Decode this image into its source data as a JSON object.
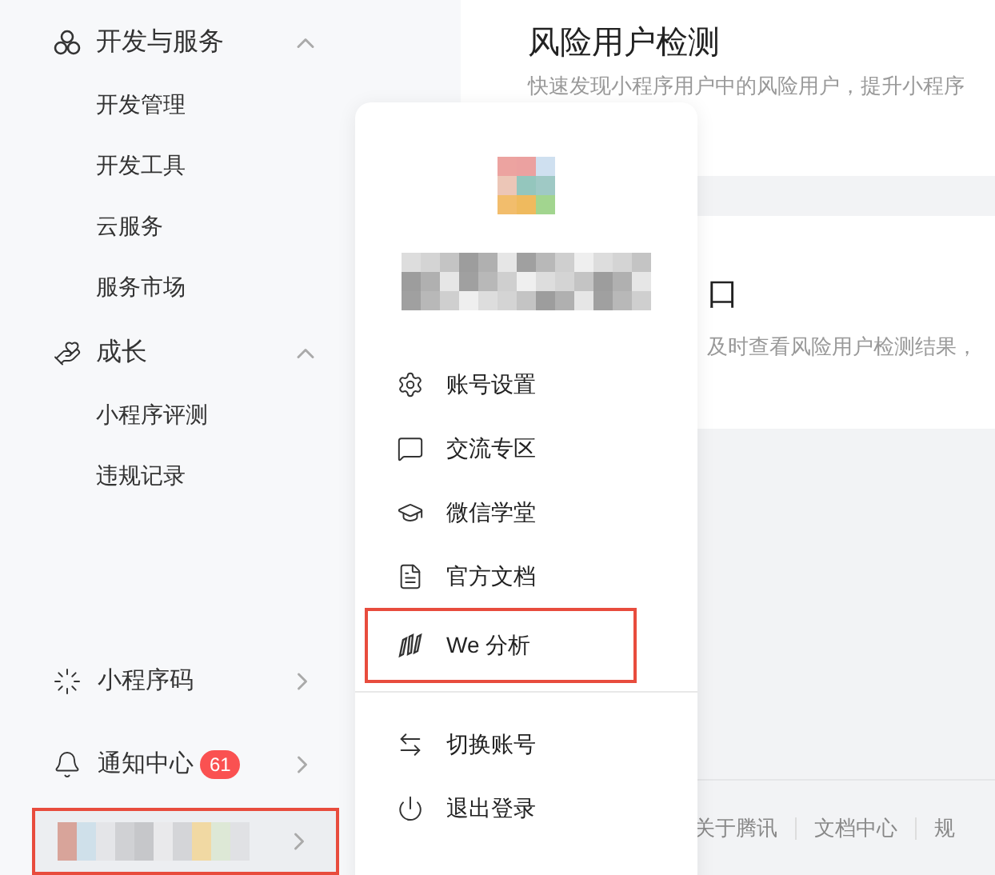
{
  "sidebar": {
    "groups": [
      {
        "title": "开发与服务",
        "expanded": true,
        "items": [
          "开发管理",
          "开发工具",
          "云服务",
          "服务市场"
        ]
      },
      {
        "title": "成长",
        "expanded": true,
        "items": [
          "小程序评测",
          "违规记录"
        ]
      }
    ],
    "bottom_items": [
      {
        "label": "小程序码"
      },
      {
        "label": "通知中心",
        "badge": "61"
      }
    ],
    "account": {
      "highlighted": true
    }
  },
  "main": {
    "cards": [
      {
        "title": "风险用户检测",
        "description": "快速发现小程序用户中的风险用户，提升小程序"
      },
      {
        "title": "口",
        "description": "及时查看风险用户检测结果，"
      }
    ],
    "footer_links": [
      "关于腾讯",
      "文档中心",
      "规"
    ]
  },
  "account_menu": {
    "items": [
      {
        "label": "账号设置",
        "highlighted": false
      },
      {
        "label": "交流专区",
        "highlighted": false
      },
      {
        "label": "微信学堂",
        "highlighted": false
      },
      {
        "label": "官方文档",
        "highlighted": false
      },
      {
        "label": "We 分析",
        "highlighted": true
      }
    ],
    "actions": [
      "切换账号",
      "退出登录"
    ]
  }
}
